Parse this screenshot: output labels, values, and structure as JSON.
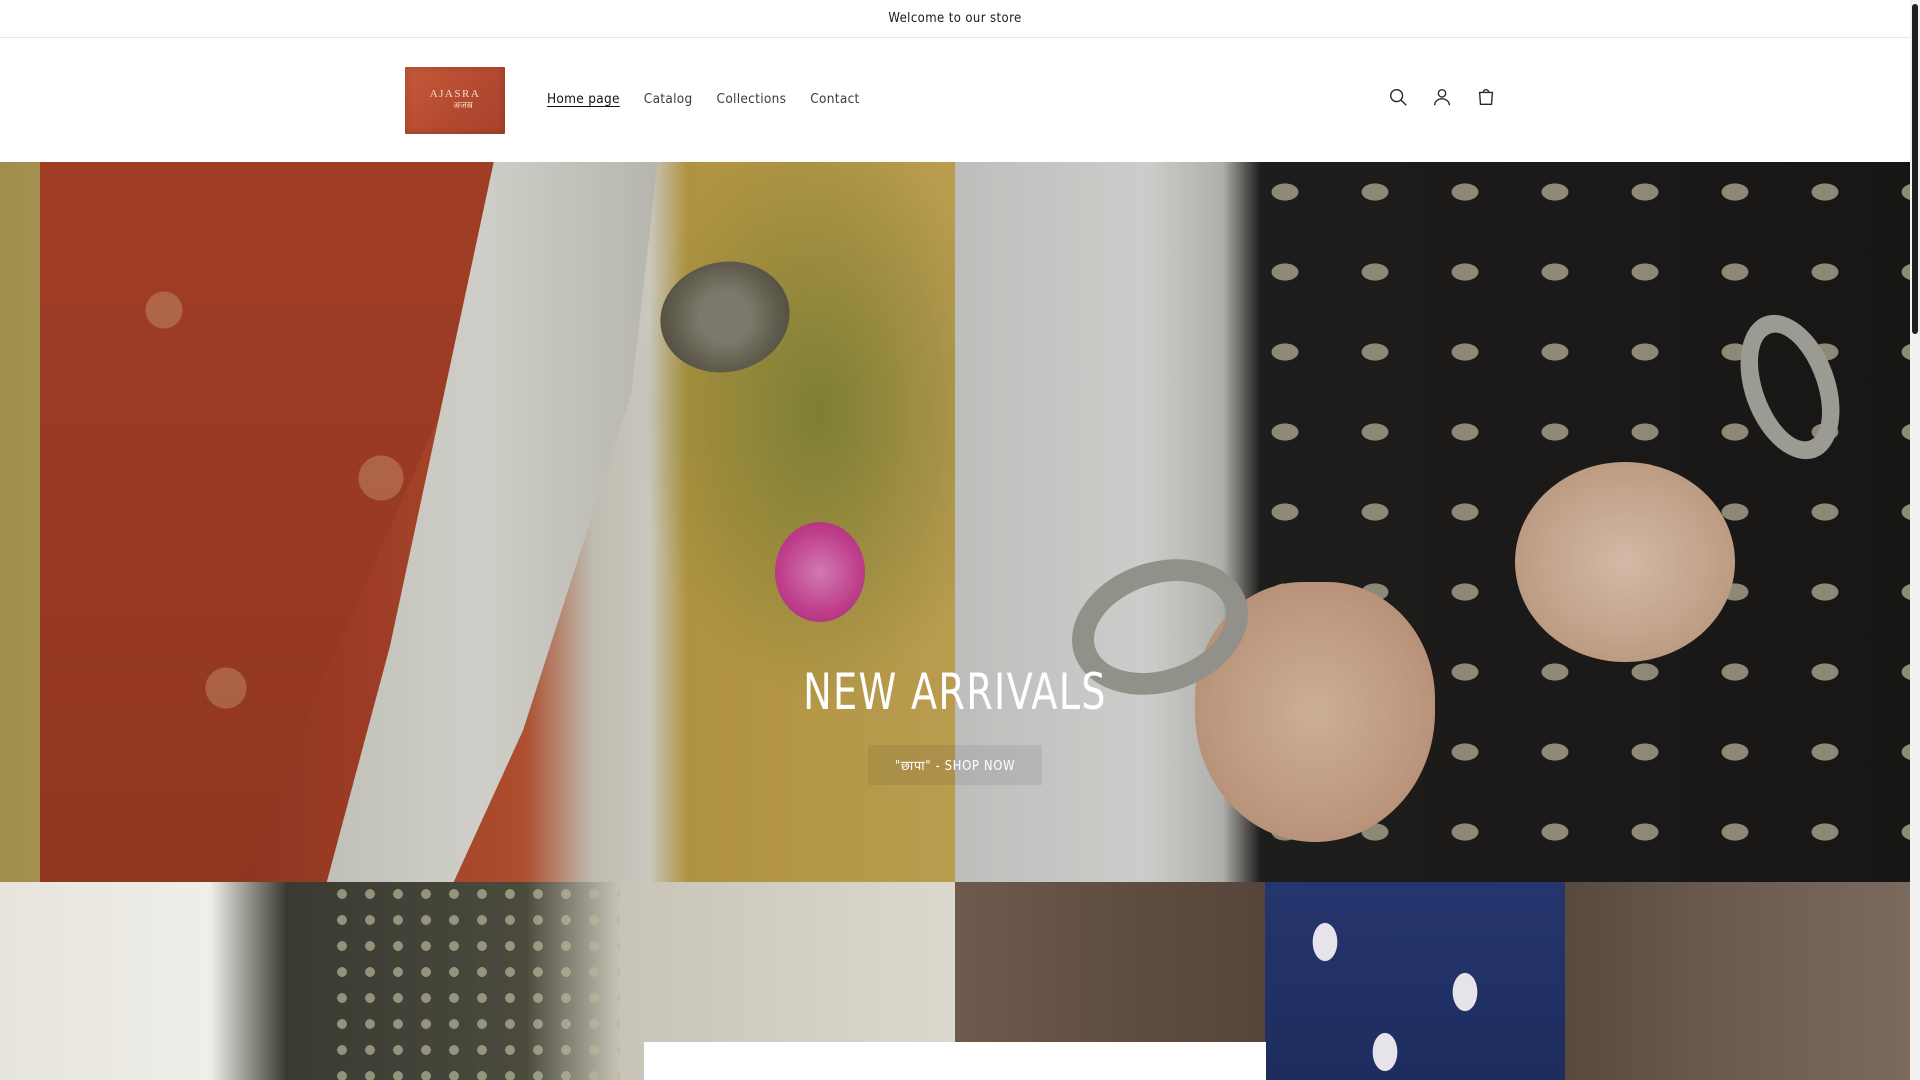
{
  "announcement": {
    "text": "Welcome to our store"
  },
  "header": {
    "logo": {
      "text_en": "AJASRA",
      "text_hi": "अजस्र"
    },
    "nav": [
      {
        "label": "Home page",
        "active": true
      },
      {
        "label": "Catalog",
        "active": false
      },
      {
        "label": "Collections",
        "active": false
      },
      {
        "label": "Contact",
        "active": false
      }
    ],
    "icons": [
      "search-icon",
      "account-icon",
      "cart-icon"
    ]
  },
  "hero": {
    "title": "NEW ARRIVALS",
    "cta_label": "\"छापा\" - SHOP NOW"
  },
  "colors": {
    "text": "#121212",
    "background": "#ffffff",
    "logo_bg": "#b44a30",
    "hero_text": "#ffffff"
  }
}
